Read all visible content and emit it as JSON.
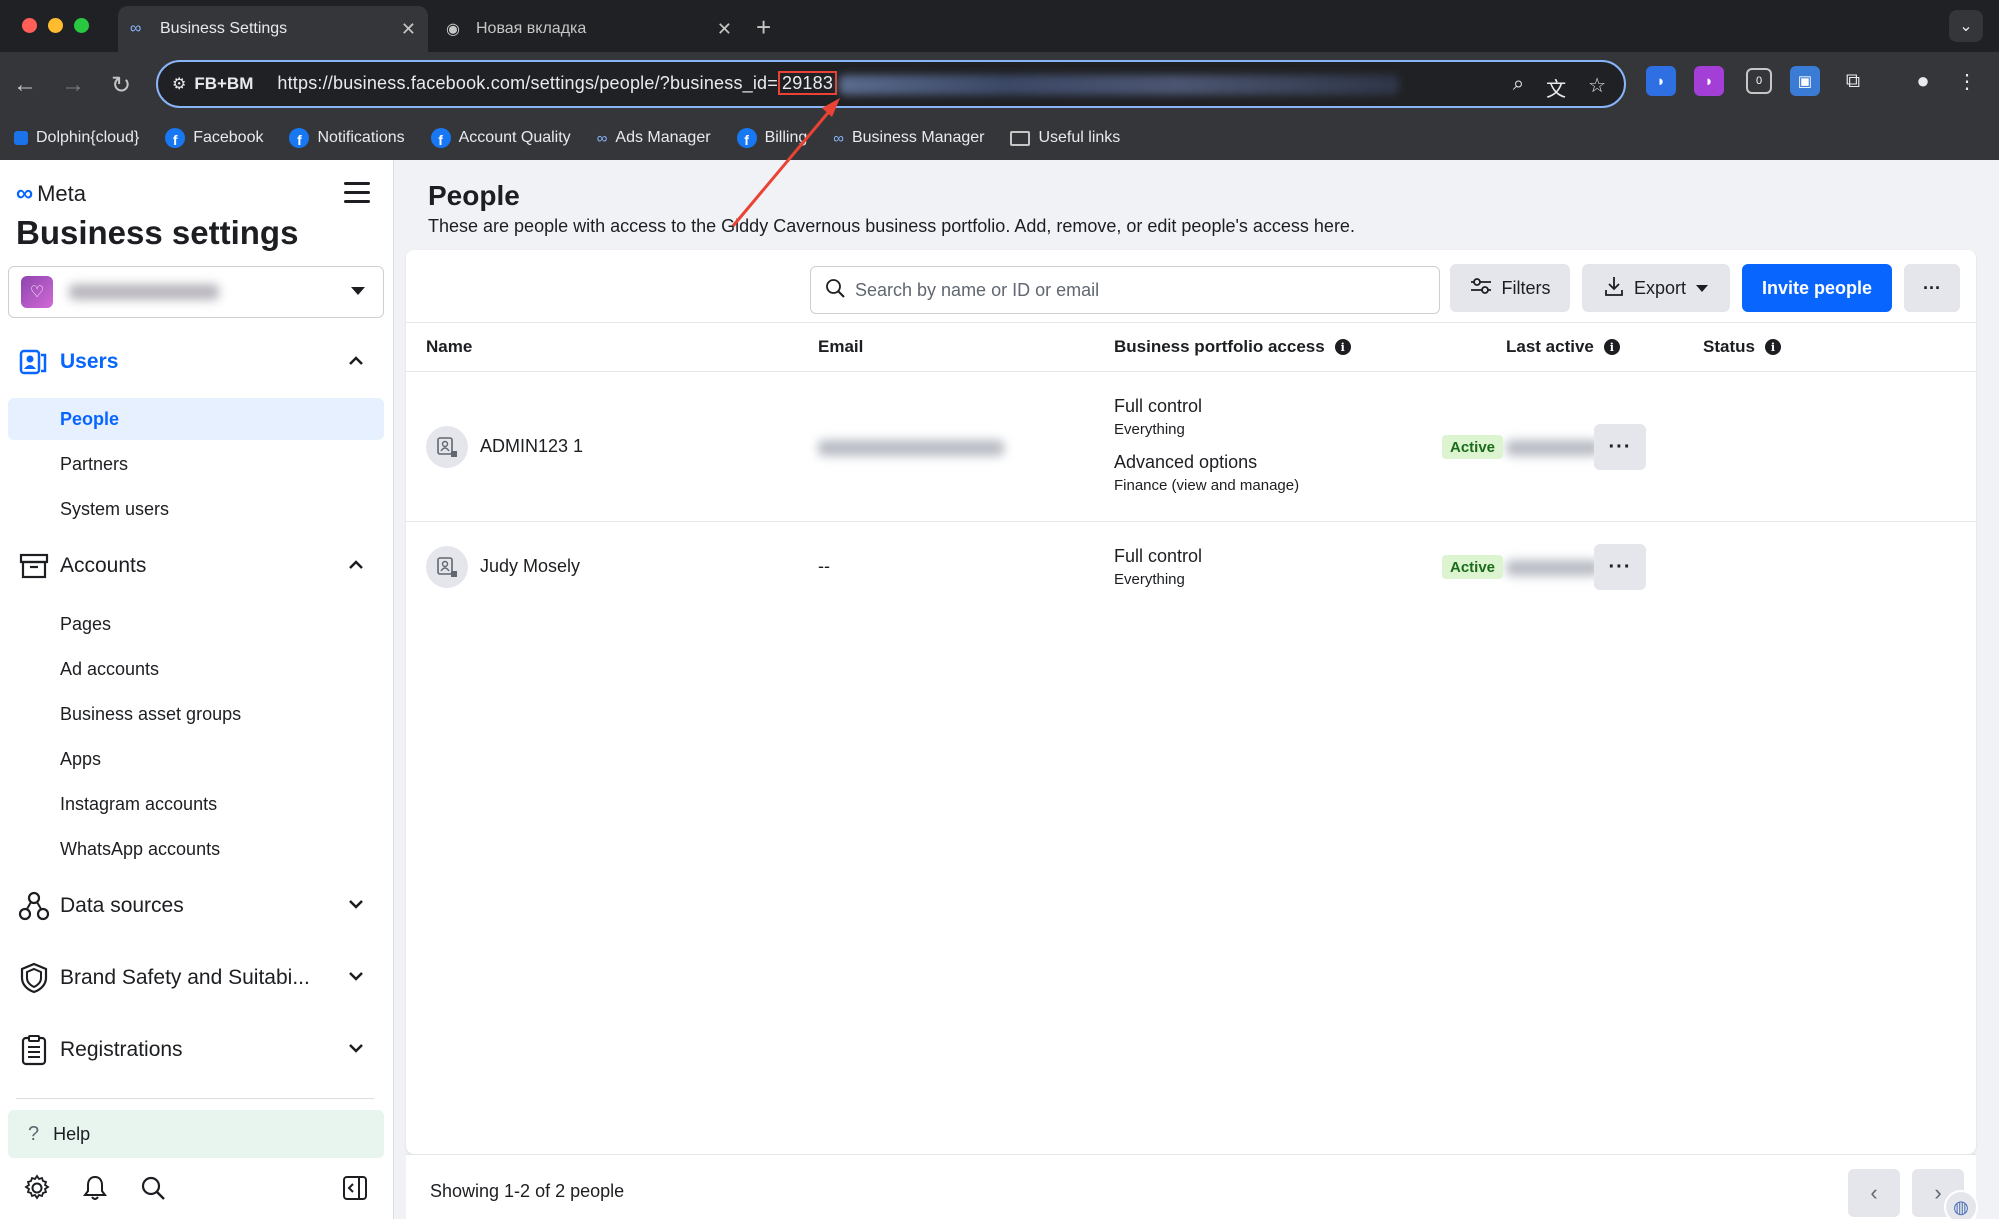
{
  "browser": {
    "tabs": [
      {
        "label": "Business Settings",
        "icon": "meta-icon"
      },
      {
        "label": "Новая вкладка",
        "icon": "chrome-icon"
      }
    ],
    "new_tab": "+",
    "site_label": "FB+BM",
    "url_prefix": "https://business.facebook.com/settings/people/?business_id=",
    "url_highlight": "29183",
    "bookmarks": [
      {
        "label": "Dolphin{cloud}",
        "icon": "dolphin-icon"
      },
      {
        "label": "Facebook",
        "icon": "facebook-icon"
      },
      {
        "label": "Notifications",
        "icon": "facebook-icon"
      },
      {
        "label": "Account Quality",
        "icon": "facebook-icon"
      },
      {
        "label": "Ads Manager",
        "icon": "meta-icon"
      },
      {
        "label": "Billing",
        "icon": "facebook-icon"
      },
      {
        "label": "Business Manager",
        "icon": "meta-icon"
      },
      {
        "label": "Useful links",
        "icon": "folder-icon"
      }
    ],
    "extension_badge": "0",
    "colors": {
      "highlight_box": "#ea4335",
      "omnibox_border": "#8ab4f8"
    }
  },
  "sidebar": {
    "brand": "Meta",
    "title": "Business settings",
    "sections": {
      "users": "Users",
      "accounts": "Accounts",
      "data_sources": "Data sources",
      "brand_safety": "Brand Safety and Suitabi...",
      "registrations": "Registrations"
    },
    "users_items": [
      "People",
      "Partners",
      "System users"
    ],
    "accounts_items": [
      "Pages",
      "Ad accounts",
      "Business asset groups",
      "Apps",
      "Instagram accounts",
      "WhatsApp accounts"
    ],
    "help": "Help"
  },
  "main": {
    "title": "People",
    "subtitle": "These are people with access to the Giddy Cavernous business portfolio. Add, remove, or edit people's access here.",
    "search_placeholder": "Search by name or ID or email",
    "filters": "Filters",
    "export": "Export",
    "invite": "Invite people",
    "more": "···",
    "columns": {
      "name": "Name",
      "email": "Email",
      "access": "Business portfolio access",
      "last_active": "Last active",
      "status": "Status"
    },
    "rows": [
      {
        "name": "ADMIN123 1",
        "email": "",
        "access_1": "Full control",
        "access_1_sub": "Everything",
        "access_2": "Advanced options",
        "access_2_sub": "Finance (view and manage)",
        "status": "Active"
      },
      {
        "name": "Judy Mosely",
        "email": "--",
        "access_1": "Full control",
        "access_1_sub": "Everything",
        "status": "Active"
      }
    ],
    "footer": "Showing 1-2 of 2 people",
    "colors": {
      "primary": "#0866ff",
      "active_badge_bg": "#dcf5d0",
      "active_badge_text": "#1b6b1b"
    }
  }
}
